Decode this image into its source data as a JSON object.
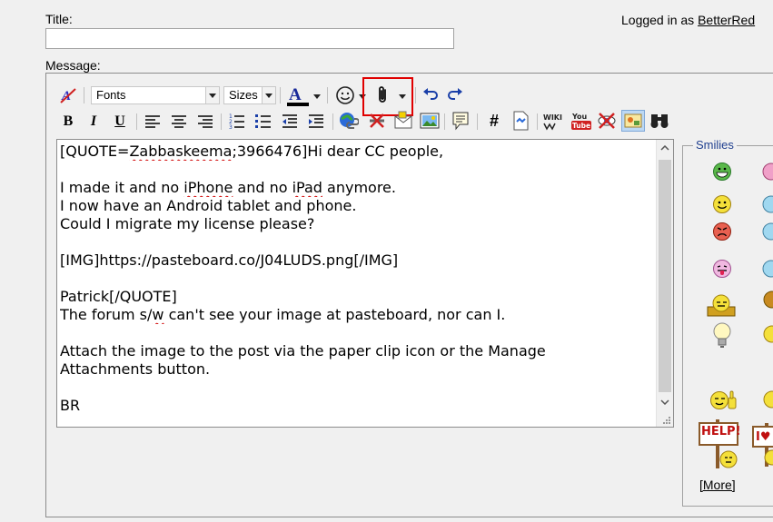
{
  "form": {
    "title_label": "Title:",
    "title_value": "",
    "message_label": "Message:"
  },
  "header": {
    "logged_in_prefix": "Logged in as ",
    "username": "BetterRed"
  },
  "toolbar": {
    "font_select": "Fonts",
    "size_select": "Sizes",
    "icons_row1": [
      "remove-format-icon",
      "font-color-icon",
      "smiley-insert-icon",
      "attach-paperclip-icon",
      "undo-icon",
      "redo-icon"
    ],
    "icons_row2": [
      "bold-icon",
      "italic-icon",
      "underline-icon",
      "align-left-icon",
      "align-center-icon",
      "align-right-icon",
      "ordered-list-icon",
      "unordered-list-icon",
      "outdent-icon",
      "indent-icon",
      "insert-link-icon",
      "remove-link-icon",
      "insert-email-icon",
      "insert-image-icon",
      "quote-icon",
      "code-hash-icon",
      "html-code-icon",
      "wiki-icon",
      "youtube-icon",
      "hide-icon",
      "insert-media-icon",
      "find-binoculars-icon"
    ],
    "bold_glyph": "B",
    "italic_glyph": "I",
    "underline_glyph": "U",
    "hash_glyph": "#",
    "font_color_glyph": "A",
    "wiki_label": "WIKI",
    "youtube_label": "You\nTube"
  },
  "editor": {
    "lines": [
      "[QUOTE=Zabbaskeema;3966476]Hi dear CC people,",
      "",
      "I made it and no iPhone and no iPad anymore.",
      "I now have an Android tablet and phone.",
      "Could I migrate my license please?",
      "",
      "[IMG]https://pasteboard.co/J04LUDS.png[/IMG]",
      "",
      "Patrick[/QUOTE]",
      "The forum s/w can't see your image at pasteboard, nor can I.",
      "",
      "Attach the image to the post via the paper clip icon or the Manage",
      "Attachments button.",
      "",
      "BR"
    ]
  },
  "smilies": {
    "legend": "Smilies",
    "more_label": "[More]",
    "help_sign": "HELP!",
    "love_sign": "I♥",
    "items": [
      "grin-smiley",
      "smile-smiley",
      "mad-smiley",
      "tongue-smiley",
      "dozing-smiley",
      "idea-smiley",
      "thumbsup-smiley",
      "help-sign-smiley",
      "love-sign-smiley"
    ]
  },
  "colors": {
    "highlight_border": "#e00000",
    "spellcheck": "#d00000",
    "smiley_yellow": "#f4e03a",
    "link_blue": "#1f3f8f"
  }
}
